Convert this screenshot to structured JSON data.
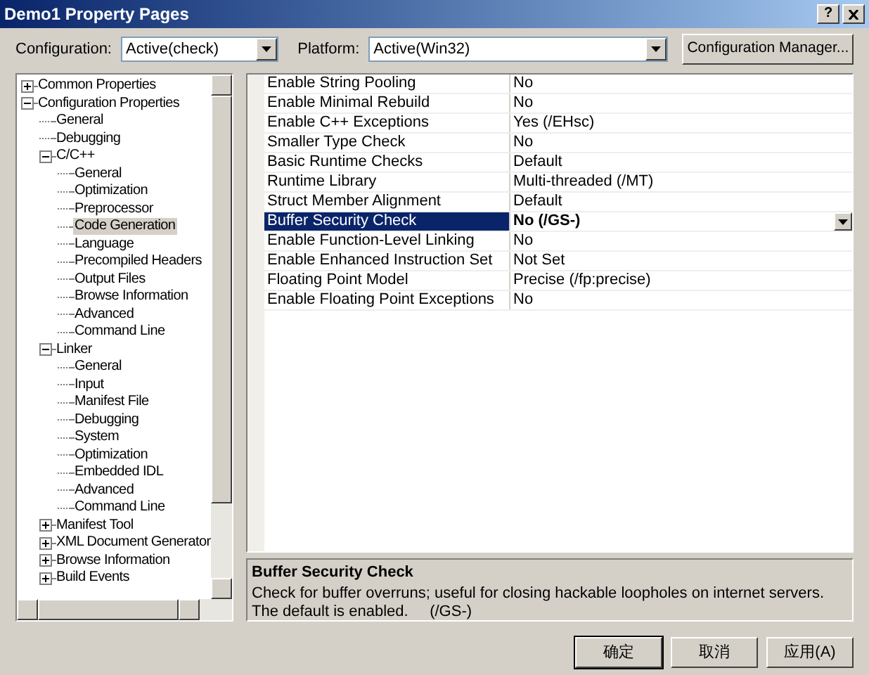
{
  "window": {
    "title": "Demo1 Property Pages",
    "help": "?"
  },
  "configuration": {
    "label": "Configuration:",
    "value": "Active(check)"
  },
  "platform": {
    "label": "Platform:",
    "value": "Active(Win32)"
  },
  "config_manager_button": "Configuration Manager...",
  "tree": [
    {
      "label": "Common Properties",
      "expanded": false,
      "selected": false
    },
    {
      "label": "Configuration Properties",
      "expanded": true,
      "selected": false,
      "children": [
        {
          "label": "General",
          "selected": false
        },
        {
          "label": "Debugging",
          "selected": false
        },
        {
          "label": "C/C++",
          "expanded": true,
          "selected": false,
          "children": [
            {
              "label": "General",
              "selected": false
            },
            {
              "label": "Optimization",
              "selected": false
            },
            {
              "label": "Preprocessor",
              "selected": false
            },
            {
              "label": "Code Generation",
              "selected": true
            },
            {
              "label": "Language",
              "selected": false
            },
            {
              "label": "Precompiled Headers",
              "selected": false
            },
            {
              "label": "Output Files",
              "selected": false
            },
            {
              "label": "Browse Information",
              "selected": false
            },
            {
              "label": "Advanced",
              "selected": false
            },
            {
              "label": "Command Line",
              "selected": false
            }
          ]
        },
        {
          "label": "Linker",
          "expanded": true,
          "selected": false,
          "children": [
            {
              "label": "General",
              "selected": false
            },
            {
              "label": "Input",
              "selected": false
            },
            {
              "label": "Manifest File",
              "selected": false
            },
            {
              "label": "Debugging",
              "selected": false
            },
            {
              "label": "System",
              "selected": false
            },
            {
              "label": "Optimization",
              "selected": false
            },
            {
              "label": "Embedded IDL",
              "selected": false
            },
            {
              "label": "Advanced",
              "selected": false
            },
            {
              "label": "Command Line",
              "selected": false
            }
          ]
        },
        {
          "label": "Manifest Tool",
          "expanded": false,
          "selected": false
        },
        {
          "label": "XML Document Generator",
          "expanded": false,
          "selected": false
        },
        {
          "label": "Browse Information",
          "expanded": false,
          "selected": false
        },
        {
          "label": "Build Events",
          "expanded": false,
          "selected": false
        }
      ]
    }
  ],
  "properties": [
    {
      "name": "Enable String Pooling",
      "value": "No",
      "selected": false
    },
    {
      "name": "Enable Minimal Rebuild",
      "value": "No",
      "selected": false
    },
    {
      "name": "Enable C++ Exceptions",
      "value": "Yes (/EHsc)",
      "selected": false
    },
    {
      "name": "Smaller Type Check",
      "value": "No",
      "selected": false
    },
    {
      "name": "Basic Runtime Checks",
      "value": "Default",
      "selected": false
    },
    {
      "name": "Runtime Library",
      "value": "Multi-threaded (/MT)",
      "selected": false
    },
    {
      "name": "Struct Member Alignment",
      "value": "Default",
      "selected": false
    },
    {
      "name": "Buffer Security Check",
      "value": "No (/GS-)",
      "selected": true
    },
    {
      "name": "Enable Function-Level Linking",
      "value": "No",
      "selected": false
    },
    {
      "name": "Enable Enhanced Instruction Set",
      "value": "Not Set",
      "selected": false
    },
    {
      "name": "Floating Point Model",
      "value": "Precise (/fp:precise)",
      "selected": false
    },
    {
      "name": "Enable Floating Point Exceptions",
      "value": "No",
      "selected": false
    }
  ],
  "description": {
    "title": "Buffer Security Check",
    "text": "Check for buffer overruns; useful for closing hackable loopholes on internet servers.  The default is enabled.     (/GS-)"
  },
  "buttons": [
    "确定",
    "取消",
    "应用(A)"
  ]
}
